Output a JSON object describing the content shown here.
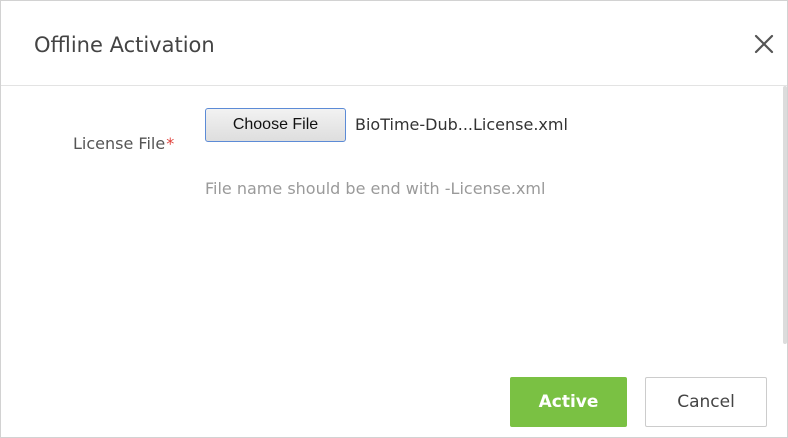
{
  "dialog": {
    "title": "Offline Activation",
    "close_icon": "close-icon"
  },
  "form": {
    "license_label": "License File",
    "required_mark": "*",
    "choose_file_label": "Choose File",
    "selected_file_name": "BioTime-Dub...License.xml",
    "hint": "File name should be end with -License.xml"
  },
  "footer": {
    "active_label": "Active",
    "cancel_label": "Cancel"
  },
  "colors": {
    "primary_button": "#7ac143",
    "required": "#e0403a",
    "hint_text": "#9a9a9a"
  }
}
